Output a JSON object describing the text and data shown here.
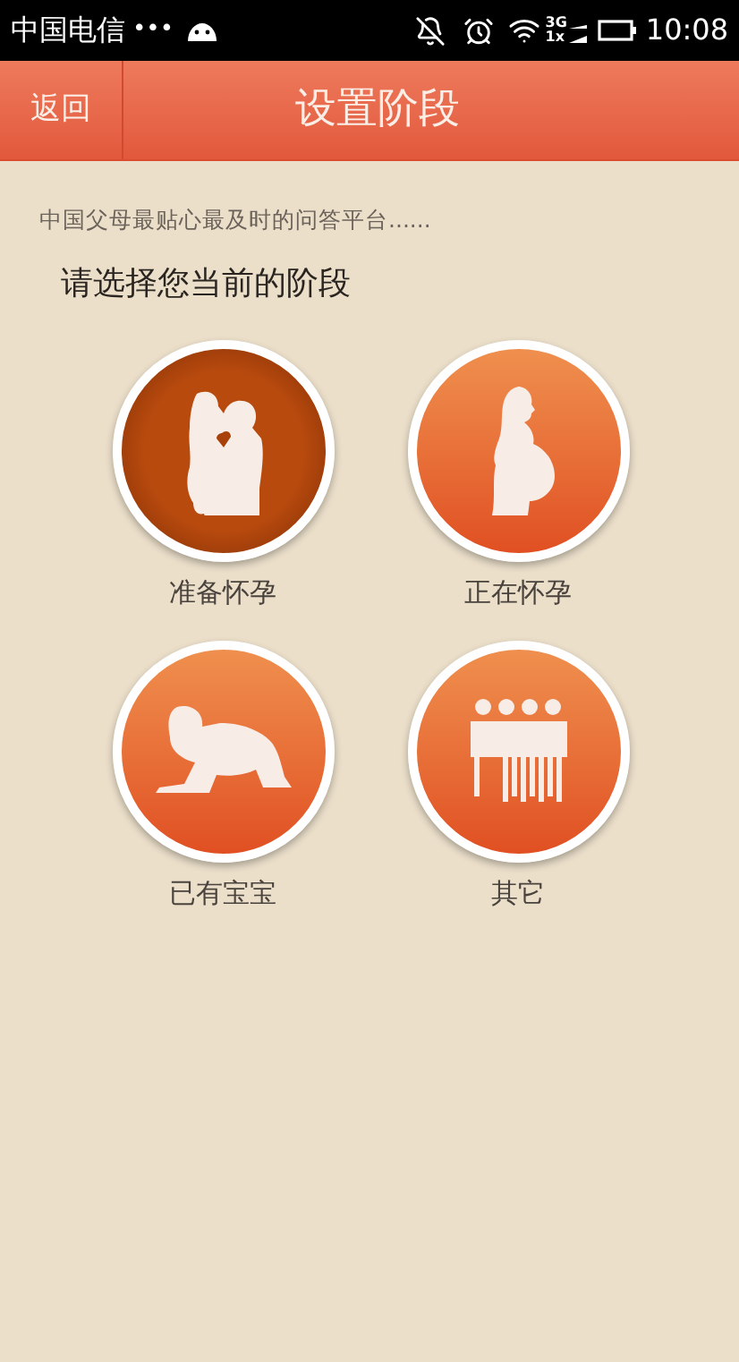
{
  "status_bar": {
    "carrier": "中国电信",
    "dots": "•••",
    "network_top": "3G",
    "network_bottom": "1x",
    "time": "10:08"
  },
  "header": {
    "back": "返回",
    "title": "设置阶段"
  },
  "tagline": "中国父母最贴心最及时的问答平台......",
  "prompt": "请选择您当前的阶段",
  "stages": [
    {
      "label": "准备怀孕",
      "kind": "couple",
      "selected": true
    },
    {
      "label": "正在怀孕",
      "kind": "pregnant",
      "selected": false
    },
    {
      "label": "已有宝宝",
      "kind": "baby",
      "selected": false
    },
    {
      "label": "其它",
      "kind": "group",
      "selected": false
    }
  ]
}
